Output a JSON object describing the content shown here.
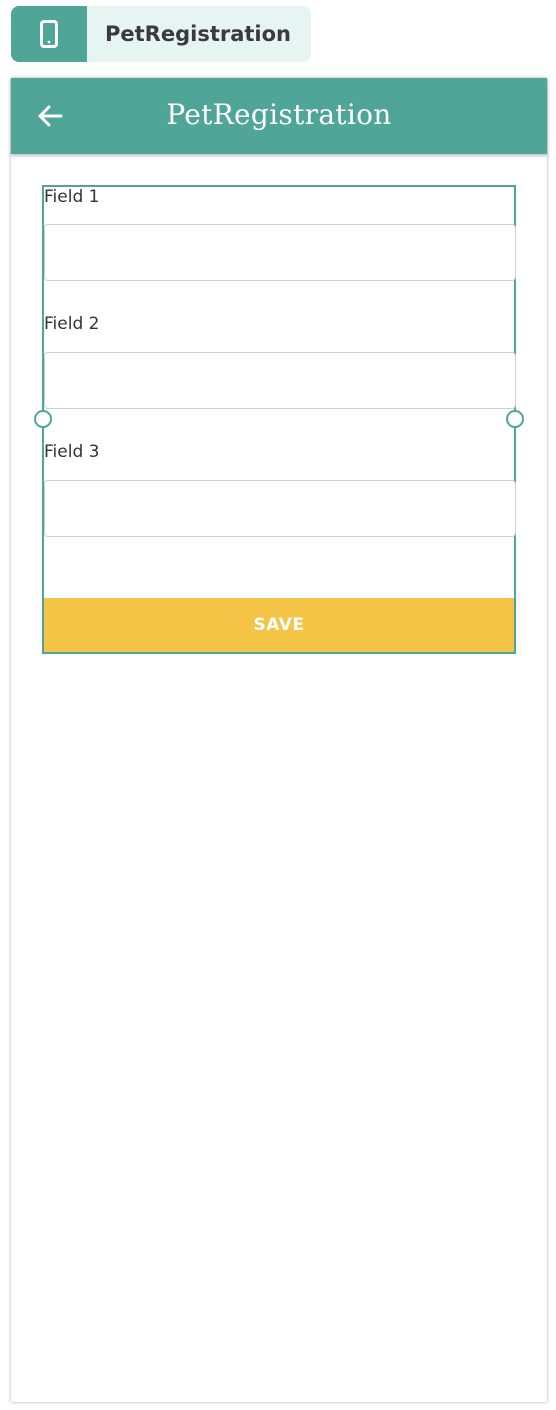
{
  "chip": {
    "icon": "mobile-phone-icon",
    "label": "PetRegistration"
  },
  "app_bar": {
    "back_icon": "arrow-left-icon",
    "title": "PetRegistration"
  },
  "form": {
    "fields": [
      {
        "label": "Field 1",
        "value": "",
        "placeholder": ""
      },
      {
        "label": "Field 2",
        "value": "",
        "placeholder": ""
      },
      {
        "label": "Field 3",
        "value": "",
        "placeholder": ""
      }
    ],
    "save_label": "SAVE"
  },
  "colors": {
    "primary": "#4fa597",
    "accent": "#f4c447",
    "chip_background": "#e6f4f2"
  }
}
